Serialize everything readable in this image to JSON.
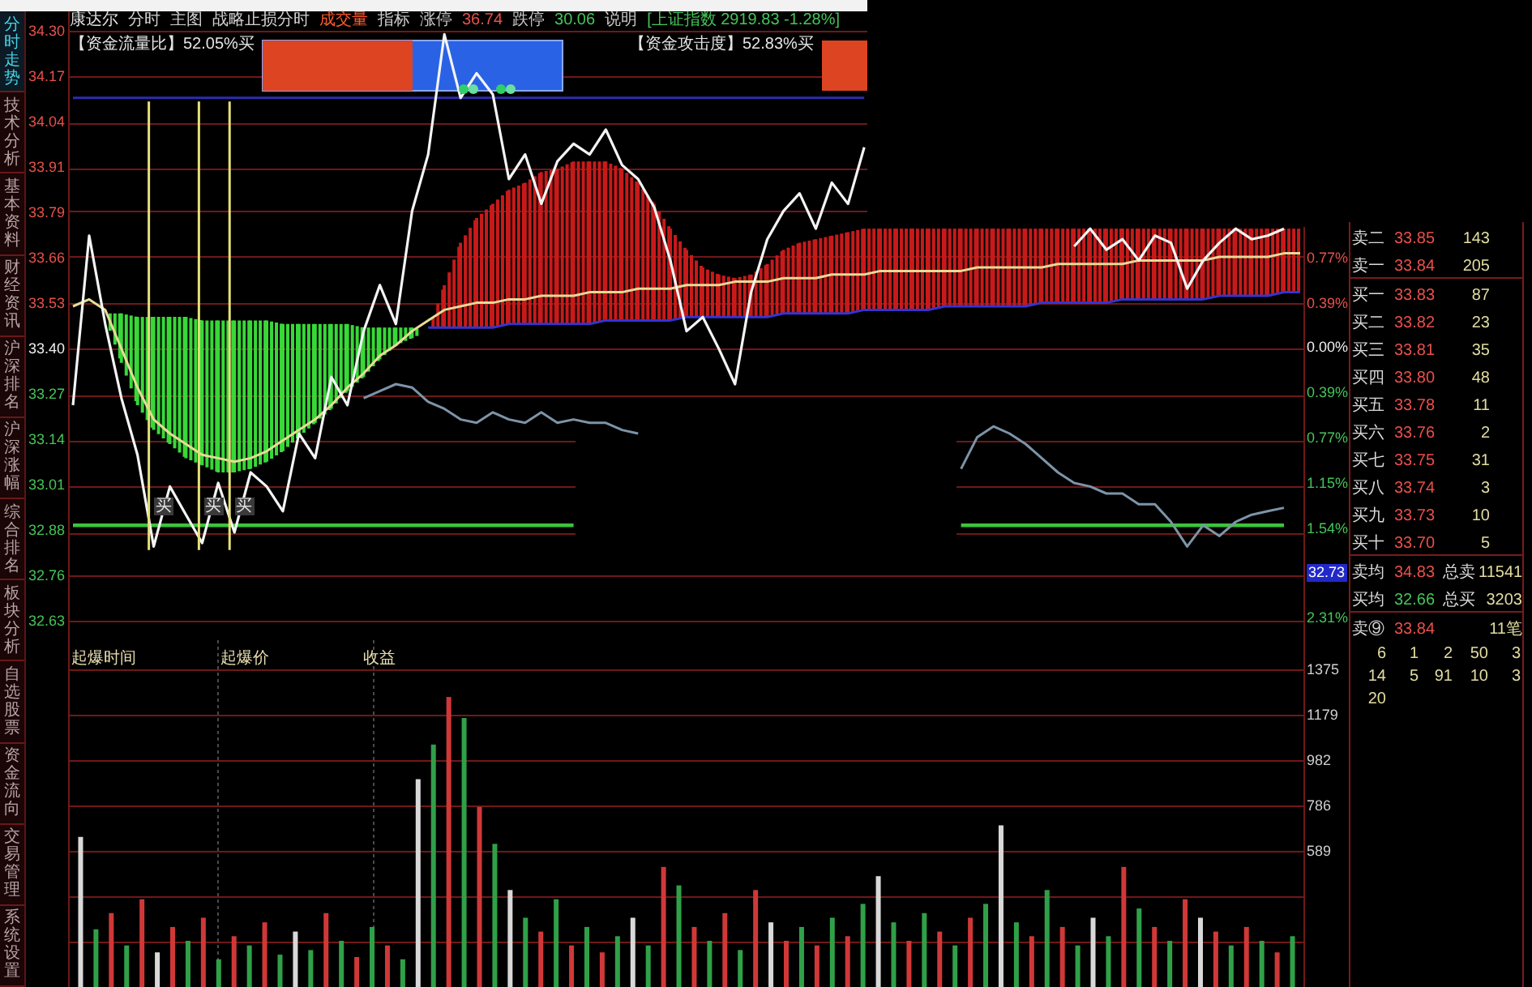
{
  "side_tabs": [
    {
      "label": "分时走势",
      "selected": true
    },
    {
      "label": "技术分析",
      "selected": false
    },
    {
      "label": "基本资料",
      "selected": false
    },
    {
      "label": "财经资讯",
      "selected": false
    },
    {
      "label": "沪深排名",
      "selected": false
    },
    {
      "label": "沪深涨幅",
      "selected": false
    },
    {
      "label": "综合排名",
      "selected": false
    },
    {
      "label": "板块分析",
      "selected": false
    },
    {
      "label": "自选股票",
      "selected": false
    },
    {
      "label": "资金流向",
      "selected": false
    },
    {
      "label": "交易管理",
      "selected": false
    },
    {
      "label": "系统设置",
      "selected": false
    }
  ],
  "header": [
    {
      "kind": "title",
      "text": "康达尔"
    },
    {
      "kind": "menu",
      "text": "分时",
      "selected": false
    },
    {
      "kind": "menu",
      "text": "主图",
      "selected": false
    },
    {
      "kind": "menu",
      "text": "战略止损分时",
      "selected": false
    },
    {
      "kind": "menu",
      "text": "成交量",
      "selected": true
    },
    {
      "kind": "menu",
      "text": "指标",
      "selected": false
    },
    {
      "kind": "label",
      "text": "涨停"
    },
    {
      "kind": "rise",
      "text": "36.74"
    },
    {
      "kind": "label",
      "text": "跌停"
    },
    {
      "kind": "fall",
      "text": "30.06"
    },
    {
      "kind": "label",
      "text": "说明"
    },
    {
      "kind": "fall",
      "text": "[上证指数 2919.83 -1.28%]"
    }
  ],
  "flow_meters": [
    {
      "label": "【资金流量比】52.05%买",
      "level": 0.5
    },
    {
      "label": "【资金攻击度】52.83%买"
    }
  ],
  "price_chart": {
    "price_axis": [
      {
        "kind": "rise"
      },
      {
        "kind": "rise"
      },
      {
        "kind": "rise"
      },
      {
        "kind": "rise"
      },
      {
        "kind": "rise"
      },
      {
        "kind": "rise"
      },
      {
        "kind": "rise"
      },
      {
        "kind": "flat"
      },
      {
        "kind": "fall"
      },
      {
        "kind": "fall"
      },
      {
        "kind": "fall"
      },
      {
        "kind": "fall"
      },
      {
        "kind": "fall"
      },
      {
        "kind": "fall"
      }
    ],
    "chart_data": {
      "type": "line",
      "grid": true,
      "ylim": [
        32.63,
        34.3
      ],
      "yticks": [
        {
          "value": 34.3,
          "label": "34.30"
        },
        {
          "value": 34.17,
          "label": "34.17"
        },
        {
          "value": 34.04,
          "label": "34.04"
        },
        {
          "value": 33.91,
          "label": "33.91"
        },
        {
          "value": 33.79,
          "label": "33.79"
        },
        {
          "value": 33.66,
          "label": "33.66"
        },
        {
          "value": 33.53,
          "label": "33.53"
        },
        {
          "value": 33.4,
          "label": "33.40"
        },
        {
          "value": 33.27,
          "label": "33.27"
        },
        {
          "value": 33.14,
          "label": "33.14"
        },
        {
          "value": 33.01,
          "label": "33.01"
        },
        {
          "value": 32.88,
          "label": "32.88"
        },
        {
          "value": 32.76,
          "label": "32.76"
        },
        {
          "value": 32.63,
          "label": "32.63"
        }
      ],
      "series": [
        {
          "color": "#2c2cb0",
          "values": [
            34.11,
            34.11,
            34.11,
            34.11,
            34.11,
            34.11,
            34.11,
            34.11,
            34.11,
            34.11,
            34.11,
            34.11,
            34.11,
            34.11,
            34.11,
            34.11,
            34.11,
            34.11,
            34.11,
            34.11,
            34.11,
            34.11,
            34.11,
            34.11,
            34.11,
            34.11,
            34.11,
            34.11,
            34.11,
            34.11,
            34.11,
            34.11,
            34.11,
            34.11,
            34.11,
            34.11,
            34.11,
            34.11,
            34.11,
            34.11,
            34.11,
            34.11,
            34.11,
            34.11,
            34.11,
            34.11,
            34.11,
            34.11,
            34.11,
            34.11,
            null,
            null,
            null,
            null,
            null,
            null,
            null,
            null,
            null,
            null,
            null,
            null,
            null,
            null,
            null,
            null,
            null,
            null,
            null,
            null,
            null,
            null,
            null,
            null,
            null,
            null,
            null
          ]
        },
        {
          "color": "#3434d0",
          "values": [
            null,
            null,
            null,
            null,
            null,
            null,
            null,
            null,
            null,
            null,
            null,
            null,
            null,
            null,
            null,
            null,
            null,
            null,
            null,
            null,
            null,
            null,
            33.46,
            33.46,
            33.46,
            33.46,
            33.46,
            33.47,
            33.47,
            33.47,
            33.47,
            33.47,
            33.47,
            33.48,
            33.48,
            33.48,
            33.48,
            33.48,
            33.49,
            33.49,
            33.49,
            33.49,
            33.49,
            33.49,
            33.5,
            33.5,
            33.5,
            33.5,
            33.5,
            33.51,
            33.51,
            33.51,
            33.51,
            33.51,
            33.52,
            33.52,
            33.52,
            33.52,
            33.52,
            33.52,
            33.53,
            33.53,
            33.53,
            33.53,
            33.53,
            33.54,
            33.54,
            33.54,
            33.54,
            33.54,
            33.54,
            33.55,
            33.55,
            33.55,
            33.55,
            33.56,
            33.56
          ]
        },
        {
          "color": "#3cc43c",
          "values": [
            32.9,
            32.9,
            32.9,
            32.9,
            32.9,
            32.9,
            32.9,
            32.9,
            32.9,
            32.9,
            32.9,
            32.9,
            32.9,
            32.9,
            32.9,
            32.9,
            32.9,
            32.9,
            32.9,
            32.9,
            32.9,
            32.9,
            32.9,
            32.9,
            32.9,
            32.9,
            32.9,
            32.9,
            32.9,
            32.9,
            32.9,
            32.9,
            null,
            null,
            null,
            null,
            null,
            null,
            null,
            null,
            null,
            null,
            null,
            null,
            null,
            null,
            null,
            null,
            null,
            null,
            null,
            null,
            null,
            null,
            null,
            32.9,
            32.9,
            32.9,
            32.9,
            32.9,
            32.9,
            32.9,
            32.9,
            32.9,
            32.9,
            32.9,
            32.9,
            32.9,
            32.9,
            32.9,
            32.9,
            32.9,
            32.9,
            32.9,
            32.9,
            32.9,
            null
          ]
        },
        {
          "color": "#7d94a8",
          "values": [
            null,
            null,
            null,
            null,
            null,
            null,
            null,
            null,
            null,
            null,
            null,
            null,
            null,
            null,
            null,
            null,
            null,
            null,
            33.26,
            33.28,
            33.3,
            33.29,
            33.25,
            33.23,
            33.2,
            33.19,
            33.22,
            33.2,
            33.19,
            33.22,
            33.19,
            33.2,
            33.19,
            33.19,
            33.17,
            33.16,
            null,
            null,
            null,
            null,
            null,
            null,
            null,
            null,
            null,
            null,
            null,
            null,
            null,
            null,
            null,
            null,
            null,
            null,
            null,
            33.06,
            33.15,
            33.18,
            33.16,
            33.13,
            33.09,
            33.05,
            33.02,
            33.01,
            32.99,
            32.99,
            32.96,
            32.96,
            32.91,
            32.84,
            32.9,
            32.87,
            32.91,
            32.93,
            32.94,
            32.95,
            null
          ]
        },
        {
          "color": "#e6dc96",
          "values": [
            33.52,
            33.54,
            33.51,
            33.4,
            33.29,
            33.2,
            33.16,
            33.13,
            33.1,
            33.09,
            33.08,
            33.09,
            33.11,
            33.14,
            33.17,
            33.2,
            33.24,
            33.29,
            33.33,
            33.38,
            33.41,
            33.45,
            33.48,
            33.51,
            33.52,
            33.53,
            33.53,
            33.54,
            33.54,
            33.55,
            33.55,
            33.55,
            33.56,
            33.56,
            33.56,
            33.57,
            33.57,
            33.57,
            33.58,
            33.58,
            33.58,
            33.59,
            33.59,
            33.59,
            33.6,
            33.6,
            33.6,
            33.61,
            33.61,
            33.61,
            33.62,
            33.62,
            33.62,
            33.62,
            33.62,
            33.62,
            33.63,
            33.63,
            33.63,
            33.63,
            33.63,
            33.64,
            33.64,
            33.64,
            33.64,
            33.64,
            33.65,
            33.65,
            33.65,
            33.65,
            33.65,
            33.66,
            33.66,
            33.66,
            33.66,
            33.67,
            33.67
          ]
        },
        {
          "color": "#f4f4f4",
          "values": [
            33.24,
            33.72,
            33.47,
            33.26,
            33.1,
            32.84,
            33.01,
            32.93,
            32.85,
            33.02,
            32.88,
            33.05,
            33.01,
            32.94,
            33.16,
            33.09,
            33.32,
            33.24,
            33.45,
            33.58,
            33.47,
            33.79,
            33.95,
            34.29,
            34.11,
            34.18,
            34.12,
            33.88,
            33.95,
            33.81,
            33.93,
            33.98,
            33.95,
            34.02,
            33.92,
            33.88,
            33.8,
            33.65,
            33.45,
            33.49,
            33.4,
            33.3,
            33.56,
            33.71,
            33.79,
            33.84,
            33.74,
            33.87,
            33.81,
            33.97,
            null,
            null,
            null,
            null,
            null,
            null,
            null,
            null,
            null,
            null,
            null,
            null,
            33.69,
            33.74,
            33.68,
            33.71,
            33.65,
            33.72,
            33.7,
            33.57,
            33.65,
            33.7,
            33.74,
            33.71,
            33.72,
            33.74,
            null
          ]
        }
      ],
      "annotations": [
        "买",
        "买",
        "买"
      ]
    }
  },
  "percent_axis": [
    {
      "kind": "rise",
      "label": "0.77%"
    },
    {
      "kind": "rise",
      "label": "0.39%"
    },
    {
      "kind": "flat",
      "label": "0.00%"
    },
    {
      "kind": "fall",
      "label": "0.39%"
    },
    {
      "kind": "fall",
      "label": "0.77%"
    },
    {
      "kind": "fall",
      "label": "1.15%"
    },
    {
      "kind": "fall",
      "label": "1.54%"
    },
    {
      "kind": "tag",
      "label": "32.73"
    },
    {
      "kind": "fall",
      "label": "2.31%"
    }
  ],
  "volume_chart": {
    "headings": [
      "起爆时间",
      "起爆价",
      "收益"
    ],
    "chart_data": {
      "type": "bar",
      "grid": true,
      "ylim": [
        0,
        1502
      ],
      "yticks": [
        {
          "value": 589,
          "label": "589"
        },
        {
          "value": 786,
          "label": "786"
        },
        {
          "value": 982,
          "label": "982"
        },
        {
          "value": 1179,
          "label": "1179"
        },
        {
          "value": 1375,
          "label": "1375"
        }
      ],
      "series": [
        {
          "color": "#d03838",
          "values": [
            null,
            null,
            320,
            null,
            380,
            null,
            260,
            null,
            300,
            null,
            220,
            null,
            280,
            null,
            null,
            null,
            320,
            null,
            130,
            null,
            180,
            null,
            null,
            null,
            1256,
            null,
            780,
            null,
            null,
            null,
            240,
            null,
            180,
            null,
            150,
            null,
            null,
            null,
            520,
            null,
            260,
            null,
            320,
            null,
            420,
            null,
            200,
            null,
            180,
            null,
            220,
            null,
            null,
            null,
            200,
            null,
            240,
            null,
            300,
            null,
            null,
            null,
            220,
            null,
            260,
            null,
            null,
            null,
            520,
            null,
            260,
            null,
            380,
            null,
            240,
            null,
            260,
            null,
            150,
            null
          ]
        },
        {
          "color": "#30a048",
          "values": [
            null,
            250,
            null,
            180,
            null,
            null,
            null,
            200,
            null,
            120,
            null,
            180,
            null,
            140,
            null,
            160,
            null,
            200,
            null,
            260,
            null,
            120,
            null,
            1050,
            null,
            1165,
            null,
            620,
            null,
            300,
            null,
            380,
            null,
            260,
            null,
            220,
            null,
            180,
            null,
            440,
            null,
            200,
            null,
            160,
            null,
            null,
            null,
            260,
            null,
            300,
            null,
            360,
            null,
            280,
            null,
            320,
            null,
            180,
            null,
            360,
            null,
            280,
            null,
            420,
            null,
            180,
            null,
            220,
            null,
            340,
            null,
            200,
            null,
            null,
            null,
            180,
            null,
            200,
            null,
            220
          ]
        },
        {
          "color": "#d8d8d8",
          "values": [
            650,
            null,
            null,
            null,
            null,
            150,
            null,
            null,
            null,
            null,
            null,
            null,
            null,
            null,
            240,
            null,
            null,
            null,
            null,
            null,
            null,
            null,
            900,
            null,
            null,
            null,
            null,
            null,
            420,
            null,
            null,
            null,
            null,
            null,
            null,
            null,
            300,
            null,
            null,
            null,
            null,
            null,
            null,
            null,
            null,
            280,
            null,
            null,
            null,
            null,
            null,
            null,
            480,
            null,
            null,
            null,
            null,
            null,
            null,
            null,
            700,
            null,
            null,
            null,
            null,
            null,
            300,
            null,
            null,
            null,
            null,
            null,
            null,
            300,
            null,
            null,
            null,
            null,
            null,
            null
          ]
        }
      ]
    }
  },
  "order_book": {
    "asks": [
      {
        "label": "卖二",
        "price": "33.85",
        "volume": "143"
      },
      {
        "label": "卖一",
        "price": "33.84",
        "volume": "205"
      }
    ],
    "bids": [
      {
        "label": "买一",
        "price": "33.83",
        "volume": "87"
      },
      {
        "label": "买二",
        "price": "33.82",
        "volume": "23"
      },
      {
        "label": "买三",
        "price": "33.81",
        "volume": "35"
      },
      {
        "label": "买四",
        "price": "33.80",
        "volume": "48"
      },
      {
        "label": "买五",
        "price": "33.78",
        "volume": "11"
      },
      {
        "label": "买六",
        "price": "33.76",
        "volume": "2"
      },
      {
        "label": "买七",
        "price": "33.75",
        "volume": "31"
      },
      {
        "label": "买八",
        "price": "33.74",
        "volume": "3"
      },
      {
        "label": "买九",
        "price": "33.73",
        "volume": "10"
      },
      {
        "label": "买十",
        "price": "33.70",
        "volume": "5"
      }
    ],
    "averages": [
      {
        "kind": "rise",
        "label": "卖均",
        "price": "34.83",
        "total_label": "总卖",
        "total": "11541"
      },
      {
        "kind": "fall",
        "label": "买均",
        "price": "32.66",
        "total_label": "总买",
        "total": "3203"
      }
    ],
    "last_trade": {
      "label": "卖⑨",
      "price": "33.84",
      "count": "11笔"
    },
    "ticks": [
      [
        "6",
        "1",
        "2",
        "50",
        "3"
      ],
      [
        "14",
        "5",
        "91",
        "10",
        "3"
      ],
      [
        "20"
      ]
    ]
  }
}
